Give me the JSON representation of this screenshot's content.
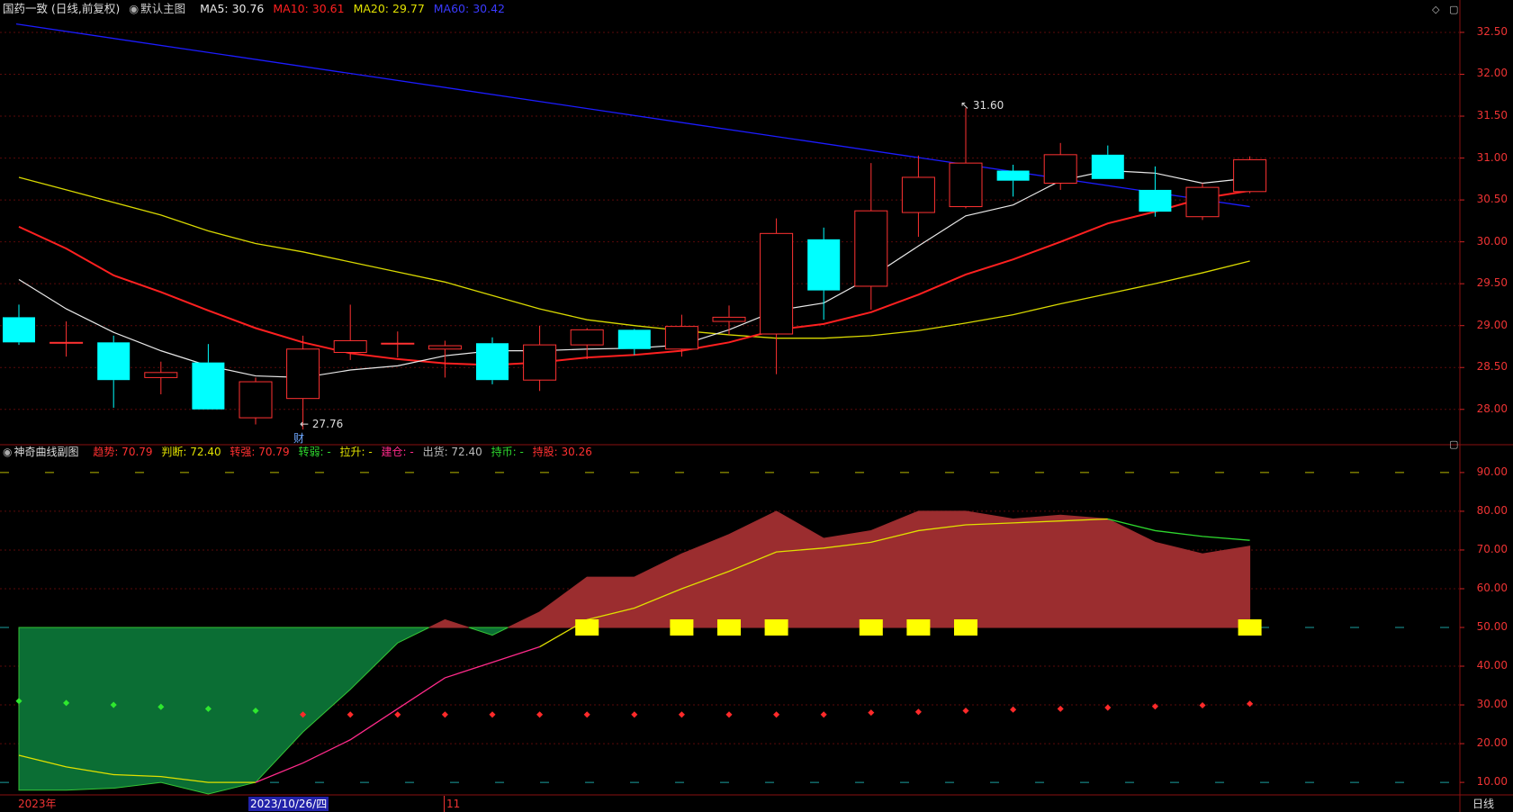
{
  "main_header": {
    "title": "国药一致 (日线,前复权)",
    "chart_mode": "默认主图",
    "ma5": "MA5: 30.76",
    "ma10": "MA10: 30.61",
    "ma20": "MA20: 29.77",
    "ma60": "MA60: 30.42"
  },
  "sub_header": {
    "title": "神奇曲线副图",
    "trend": "趋势: 70.79",
    "judge": "判断: 72.40",
    "turn_strong": "转强: 70.79",
    "turn_weak": "转弱: -",
    "pull_up": "拉升: -",
    "build": "建仓: -",
    "ship": "出货: 72.40",
    "hold": "持币: -",
    "hold_stock": "持股: 30.26"
  },
  "main_axis": [
    "32.50",
    "32.00",
    "31.50",
    "31.00",
    "30.50",
    "30.00",
    "29.50",
    "29.00",
    "28.50",
    "28.00"
  ],
  "sub_axis": [
    "90.00",
    "80.00",
    "70.00",
    "60.00",
    "50.00",
    "40.00",
    "30.00",
    "20.00",
    "10.00"
  ],
  "annotations": {
    "high": "31.60",
    "low": "27.76",
    "fin_badge": "财"
  },
  "bottom": {
    "year": "2023年",
    "date": "2023/10/26/四",
    "month": "11",
    "period": "日线"
  },
  "colors": {
    "up": "#ff3232",
    "down": "#00ffff",
    "ma5": "#e8e8e8",
    "ma10": "#ff2020",
    "ma20": "#d8d800",
    "ma60": "#1c1cff",
    "bull_fill": "#9b2d2f",
    "bear_fill": "#0b6e34"
  },
  "chart_data": {
    "type": "candlestick",
    "x": [
      "c1",
      "c2",
      "c3",
      "c4",
      "c5",
      "c6",
      "c7",
      "c8",
      "c9",
      "c10",
      "c11",
      "c12",
      "c13",
      "c14",
      "c15",
      "c16",
      "c17",
      "c18",
      "c19",
      "c20",
      "c21",
      "c22",
      "c23",
      "c24",
      "c25",
      "c26",
      "c27"
    ],
    "candles": [
      {
        "o": 29.1,
        "h": 29.25,
        "l": 28.77,
        "c": 28.8
      },
      {
        "o": 28.8,
        "h": 29.05,
        "l": 28.63,
        "c": 28.8
      },
      {
        "o": 28.8,
        "h": 28.88,
        "l": 28.02,
        "c": 28.35
      },
      {
        "o": 28.38,
        "h": 28.57,
        "l": 28.18,
        "c": 28.44
      },
      {
        "o": 28.56,
        "h": 28.78,
        "l": 28.0,
        "c": 28.0
      },
      {
        "o": 27.9,
        "h": 28.38,
        "l": 27.82,
        "c": 28.33
      },
      {
        "o": 28.13,
        "h": 28.88,
        "l": 27.76,
        "c": 28.72
      },
      {
        "o": 28.68,
        "h": 29.25,
        "l": 28.59,
        "c": 28.82
      },
      {
        "o": 28.79,
        "h": 28.93,
        "l": 28.62,
        "c": 28.79
      },
      {
        "o": 28.72,
        "h": 28.82,
        "l": 28.38,
        "c": 28.76
      },
      {
        "o": 28.79,
        "h": 28.86,
        "l": 28.3,
        "c": 28.35
      },
      {
        "o": 28.35,
        "h": 29.0,
        "l": 28.22,
        "c": 28.77
      },
      {
        "o": 28.77,
        "h": 28.97,
        "l": 28.6,
        "c": 28.95
      },
      {
        "o": 28.95,
        "h": 28.96,
        "l": 28.65,
        "c": 28.72
      },
      {
        "o": 28.72,
        "h": 29.13,
        "l": 28.63,
        "c": 28.99
      },
      {
        "o": 29.05,
        "h": 29.24,
        "l": 28.89,
        "c": 29.1
      },
      {
        "o": 28.9,
        "h": 30.28,
        "l": 28.42,
        "c": 30.1
      },
      {
        "o": 30.03,
        "h": 30.17,
        "l": 29.07,
        "c": 29.42
      },
      {
        "o": 29.47,
        "h": 30.94,
        "l": 29.19,
        "c": 30.37
      },
      {
        "o": 30.35,
        "h": 31.03,
        "l": 30.06,
        "c": 30.77
      },
      {
        "o": 30.42,
        "h": 31.6,
        "l": 30.4,
        "c": 30.94
      },
      {
        "o": 30.85,
        "h": 30.92,
        "l": 30.54,
        "c": 30.73
      },
      {
        "o": 30.7,
        "h": 31.18,
        "l": 30.62,
        "c": 31.04
      },
      {
        "o": 31.04,
        "h": 31.15,
        "l": 30.75,
        "c": 30.75
      },
      {
        "o": 30.62,
        "h": 30.9,
        "l": 30.3,
        "c": 30.36
      },
      {
        "o": 30.3,
        "h": 30.7,
        "l": 30.26,
        "c": 30.65
      },
      {
        "o": 30.6,
        "h": 31.02,
        "l": 30.58,
        "c": 30.98
      }
    ],
    "ma5": [
      29.55,
      29.2,
      28.92,
      28.7,
      28.52,
      28.4,
      28.38,
      28.47,
      28.52,
      28.64,
      28.7,
      28.7,
      28.72,
      28.73,
      28.77,
      28.95,
      29.18,
      29.27,
      29.58,
      29.95,
      30.31,
      30.44,
      30.73,
      30.85,
      30.82,
      30.7,
      30.76
    ],
    "ma10": [
      30.18,
      29.92,
      29.6,
      29.4,
      29.18,
      28.97,
      28.8,
      28.67,
      28.6,
      28.55,
      28.53,
      28.56,
      28.62,
      28.65,
      28.7,
      28.8,
      28.95,
      29.02,
      29.16,
      29.37,
      29.61,
      29.79,
      30.0,
      30.22,
      30.36,
      30.52,
      30.61
    ],
    "ma20": [
      30.77,
      30.62,
      30.47,
      30.32,
      30.13,
      29.98,
      29.88,
      29.76,
      29.64,
      29.52,
      29.36,
      29.2,
      29.07,
      29.0,
      28.94,
      28.89,
      28.85,
      28.85,
      28.88,
      28.94,
      29.03,
      29.13,
      29.26,
      29.38,
      29.5,
      29.63,
      29.77
    ],
    "ma60_start": 32.6,
    "ma60_end": 30.42,
    "ylim": [
      27.6,
      32.65
    ],
    "sub": {
      "ylim": [
        7,
        93
      ],
      "trend": [
        8,
        8,
        8.5,
        10,
        7,
        10,
        23,
        34,
        46,
        52,
        48,
        54,
        63,
        63,
        69,
        74,
        80,
        73,
        75,
        80,
        80,
        78,
        79,
        78,
        72,
        69,
        71
      ],
      "judge": [
        17,
        14,
        12,
        11.5,
        10,
        10,
        15,
        21,
        29,
        37,
        41,
        45,
        52,
        55,
        60,
        64.5,
        69.5,
        70.5,
        72,
        75,
        76.5,
        77,
        77.5,
        78,
        75,
        73.5,
        72.5
      ],
      "dots": [
        31,
        30.5,
        30,
        29.5,
        29,
        28.5,
        27.5,
        27.5,
        27.5,
        27.5,
        27.5,
        27.5,
        27.5,
        27.5,
        27.5,
        27.5,
        27.5,
        27.5,
        28,
        28.2,
        28.5,
        28.8,
        29,
        29.3,
        29.6,
        29.9,
        30.3
      ],
      "dot_green_count": 6,
      "markers": [
        12,
        14,
        15,
        16,
        18,
        19,
        20,
        26
      ]
    }
  }
}
